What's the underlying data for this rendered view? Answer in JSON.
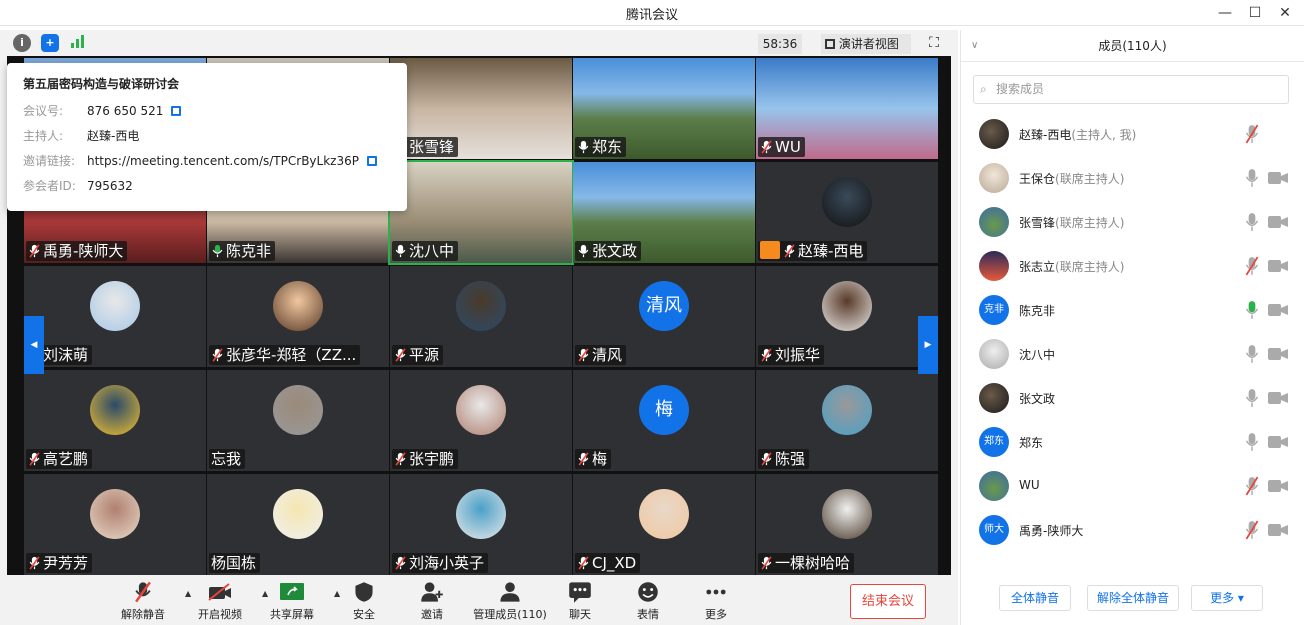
{
  "window": {
    "title": "腾讯会议"
  },
  "topbar": {
    "timer": "58:36",
    "view_label": "演讲者视图"
  },
  "info": {
    "title": "第五届密码构造与破译研讨会",
    "rows": [
      {
        "label": "会议号:",
        "value": "876 650 521",
        "copy": true
      },
      {
        "label": "主持人:",
        "value": "赵臻-西电",
        "copy": false
      },
      {
        "label": "邀请链接:",
        "value": "https://meeting.tencent.com/s/TPCrByLkz36P",
        "copy": true
      },
      {
        "label": "参会者ID:",
        "value": "795632",
        "copy": false
      }
    ]
  },
  "grid": [
    {
      "name": "",
      "mic": "none",
      "bg": "video-pink"
    },
    {
      "name": "",
      "mic": "none",
      "bg": "video-room"
    },
    {
      "name": "张雪锋",
      "mic": "on",
      "bg": "video-face"
    },
    {
      "name": "郑东",
      "mic": "on",
      "bg": "video-landscape"
    },
    {
      "name": "WU",
      "mic": "muted",
      "bg": "video-sky"
    },
    {
      "name": "禹勇-陕师大",
      "mic": "muted",
      "bg": "video-red"
    },
    {
      "name": "陈克非",
      "mic": "speaking",
      "bg": "video-shelf"
    },
    {
      "name": "沈八中",
      "mic": "on",
      "bg": "video-shelf2"
    },
    {
      "name": "张文政",
      "mic": "on",
      "bg": "video-landscape"
    },
    {
      "name": "赵臻-西电",
      "mic": "muted",
      "bg": "avatar",
      "host": true
    },
    {
      "name": "刘沫萌",
      "mic": "muted",
      "bg": "avatar"
    },
    {
      "name": "张彦华-郑轻（ZZ...",
      "mic": "muted",
      "bg": "avatar"
    },
    {
      "name": "平源",
      "mic": "muted",
      "bg": "avatar"
    },
    {
      "name": "清风",
      "mic": "muted",
      "bg": "avatar",
      "avatar_text": "清风"
    },
    {
      "name": "刘振华",
      "mic": "muted",
      "bg": "avatar"
    },
    {
      "name": "高艺鹏",
      "mic": "muted",
      "bg": "avatar"
    },
    {
      "name": "忘我",
      "mic": "none",
      "bg": "avatar"
    },
    {
      "name": "张宇鹏",
      "mic": "muted",
      "bg": "avatar"
    },
    {
      "name": "梅",
      "mic": "muted",
      "bg": "avatar",
      "avatar_text": "梅"
    },
    {
      "name": "陈强",
      "mic": "muted",
      "bg": "avatar"
    },
    {
      "name": "尹芳芳",
      "mic": "muted",
      "bg": "avatar"
    },
    {
      "name": "杨国栋",
      "mic": "none",
      "bg": "avatar"
    },
    {
      "name": "刘海小英子",
      "mic": "muted",
      "bg": "avatar"
    },
    {
      "name": "CJ_XD",
      "mic": "muted",
      "bg": "avatar"
    },
    {
      "name": "一棵树哈哈",
      "mic": "muted",
      "bg": "avatar"
    }
  ],
  "toolbar": {
    "items": [
      {
        "label": "解除静音",
        "icon": "mic-muted-icon",
        "caret": true
      },
      {
        "label": "开启视频",
        "icon": "video-off-icon",
        "caret": true
      },
      {
        "label": "共享屏幕",
        "icon": "share-screen-icon",
        "caret": true
      },
      {
        "label": "安全",
        "icon": "shield-icon"
      },
      {
        "label": "邀请",
        "icon": "invite-icon"
      },
      {
        "label": "管理成员(110)",
        "icon": "members-icon"
      },
      {
        "label": "聊天",
        "icon": "chat-icon"
      },
      {
        "label": "表情",
        "icon": "emoji-icon"
      },
      {
        "label": "更多",
        "icon": "more-icon"
      }
    ],
    "end_label": "结束会议"
  },
  "panel": {
    "title": "成员(110人)",
    "search_placeholder": "搜索成员",
    "members": [
      {
        "name": "赵臻-西电",
        "role": "(主持人, 我)",
        "mic": "muted",
        "cam": "none",
        "avatar": "img-dark"
      },
      {
        "name": "王保仓",
        "role": "(联席主持人)",
        "mic": "on",
        "cam": "on",
        "avatar": "img-light"
      },
      {
        "name": "张雪锋",
        "role": "(联席主持人)",
        "mic": "on",
        "cam": "on",
        "avatar": "img-green"
      },
      {
        "name": "张志立",
        "role": "(联席主持人)",
        "mic": "muted",
        "cam": "on",
        "avatar": "img-sunset"
      },
      {
        "name": "陈克非",
        "role": "",
        "mic": "speaking",
        "cam": "on",
        "avatar": "text",
        "avatar_text": "克非"
      },
      {
        "name": "沈八中",
        "role": "",
        "mic": "on",
        "cam": "on",
        "avatar": "img-gray"
      },
      {
        "name": "张文政",
        "role": "",
        "mic": "on",
        "cam": "on",
        "avatar": "img-dark"
      },
      {
        "name": "郑东",
        "role": "",
        "mic": "on",
        "cam": "on",
        "avatar": "text",
        "avatar_text": "郑东"
      },
      {
        "name": "WU",
        "role": "",
        "mic": "muted",
        "cam": "on",
        "avatar": "img-green"
      },
      {
        "name": "禹勇-陕师大",
        "role": "",
        "mic": "muted",
        "cam": "on",
        "avatar": "text",
        "avatar_text": "师大"
      }
    ],
    "buttons": [
      "全体静音",
      "解除全体静音",
      "更多"
    ]
  }
}
